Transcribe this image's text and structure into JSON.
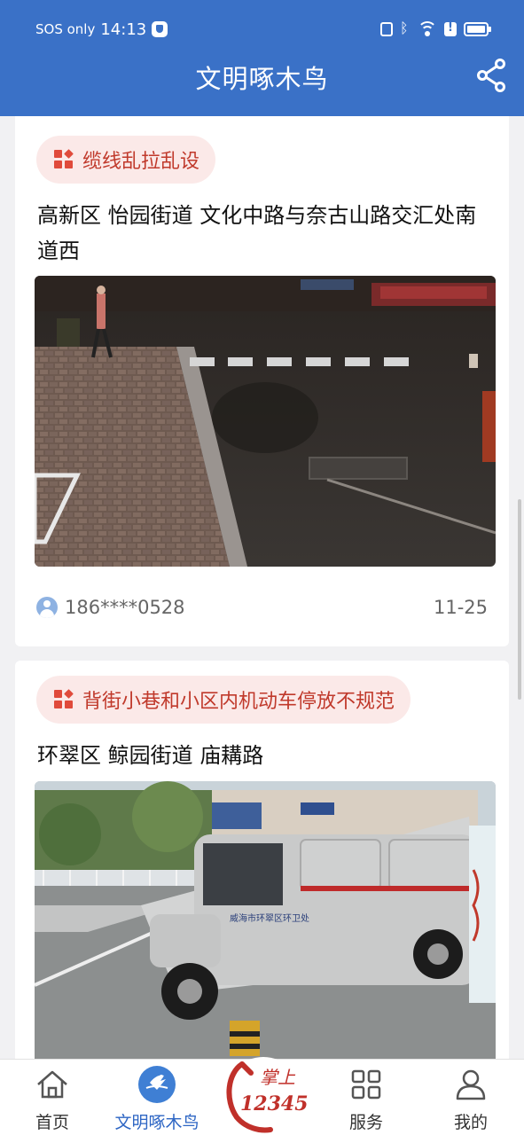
{
  "status_bar": {
    "carrier": "SOS only",
    "time": "14:13"
  },
  "header": {
    "title": "文明啄木鸟"
  },
  "cards": [
    {
      "category": "缆线乱拉乱设",
      "location": "高新区 怡园街道 文化中路与奈古山路交汇处南道西",
      "user": "186****0528",
      "date": "11-25"
    },
    {
      "category": "背街小巷和小区内机动车停放不规范",
      "location": "环翠区 鲸园街道 庙耩路",
      "van_text": "威海市环翠区环卫处"
    }
  ],
  "nav": {
    "items": [
      {
        "label": "首页"
      },
      {
        "label": "文明啄木鸟"
      },
      {
        "label": "服务"
      },
      {
        "label": "我的"
      }
    ],
    "hotline": {
      "line1": "掌上",
      "line2": "12345"
    }
  },
  "colors": {
    "header_bg": "#3a71c7",
    "tag_text": "#c0392b",
    "tag_bg": "#fbe9e8",
    "nav_active": "#2e66c4",
    "hotline_red": "#c0302a"
  }
}
